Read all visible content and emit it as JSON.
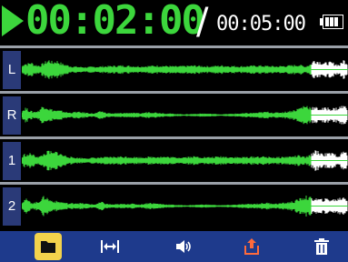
{
  "status": {
    "elapsed": "00:02:00",
    "separator": "/",
    "total": "00:05:00",
    "battery_icon": "battery-icon",
    "play_icon": "play-icon"
  },
  "colors": {
    "accent": "#3cd63c",
    "waveform": "#3cd63c",
    "label_bg": "#2a3a78",
    "toolbar_bg": "#1e3a8c",
    "selected": "#f3d24c"
  },
  "tracks": [
    {
      "label": "L"
    },
    {
      "label": "R"
    },
    {
      "label": "1"
    },
    {
      "label": "2"
    }
  ],
  "toolbar": {
    "items": [
      {
        "icon": "folder-icon",
        "selected": true
      },
      {
        "icon": "trim-icon",
        "selected": false
      },
      {
        "icon": "volume-icon",
        "selected": false
      },
      {
        "icon": "export-icon",
        "selected": false
      },
      {
        "icon": "trash-icon",
        "selected": false
      }
    ]
  }
}
